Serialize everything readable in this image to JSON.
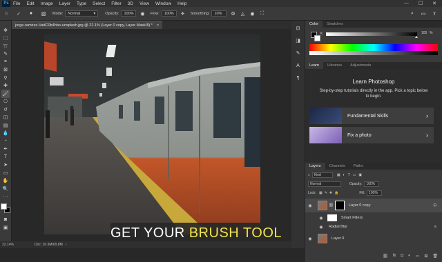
{
  "menubar": {
    "logo": "Ps",
    "items": [
      "File",
      "Edit",
      "Image",
      "Layer",
      "Type",
      "Select",
      "Filter",
      "3D",
      "View",
      "Window",
      "Help"
    ],
    "controls": [
      "—",
      "☐",
      "✕"
    ]
  },
  "options": {
    "mode_label": "Mode:",
    "mode_value": "Normal",
    "opacity_label": "Opacity:",
    "opacity_value": "100%",
    "flow_label": "Flow:",
    "flow_value": "100%",
    "smoothing_label": "Smoothing:",
    "smoothing_value": "10%"
  },
  "document": {
    "tab_title": "jorge-ramirez-VadC0b4hbo-unsplash.jpg @ 22.1% (Layer 0 copy, Layer Mask/8) *",
    "close": "×"
  },
  "status": {
    "zoom": "22.14%",
    "doc": "Doc: 26.9M/69.8M"
  },
  "caption": {
    "text": "GET YOUR",
    "highlight": "BRUSH TOOL"
  },
  "color_panel": {
    "tabs": [
      "Color",
      "Swatches"
    ],
    "slider_value": "100",
    "slider_unit": "%"
  },
  "learn_panel": {
    "tabs": [
      "Learn",
      "Libraries",
      "Adjustments"
    ],
    "title": "Learn Photoshop",
    "description": "Step-by-step tutorials directly in the app. Pick a topic below to begin.",
    "cards": [
      {
        "label": "Fundamental Skills",
        "arrow": "›"
      },
      {
        "label": "Fix a photo",
        "arrow": "›"
      }
    ]
  },
  "layers_panel": {
    "tabs": [
      "Layers",
      "Channels",
      "Paths"
    ],
    "kind_label": "Kind",
    "blend_mode": "Normal",
    "opacity_label": "Opacity:",
    "opacity_value": "100%",
    "lock_label": "Lock:",
    "fill_label": "Fill:",
    "fill_value": "100%",
    "layers": [
      {
        "name": "Layer 0 copy"
      },
      {
        "name": "Smart Filters"
      },
      {
        "name": "Radial Blur"
      },
      {
        "name": "Layer 0"
      }
    ],
    "footer_icons": [
      "link-icon",
      "fx-icon",
      "mask-icon",
      "adjustment-icon",
      "group-icon",
      "new-layer-icon",
      "trash-icon"
    ]
  },
  "colors": {
    "accent": "#31a8ff",
    "caption_highlight": "#f1e44a",
    "train_orange": "#c8562a"
  }
}
